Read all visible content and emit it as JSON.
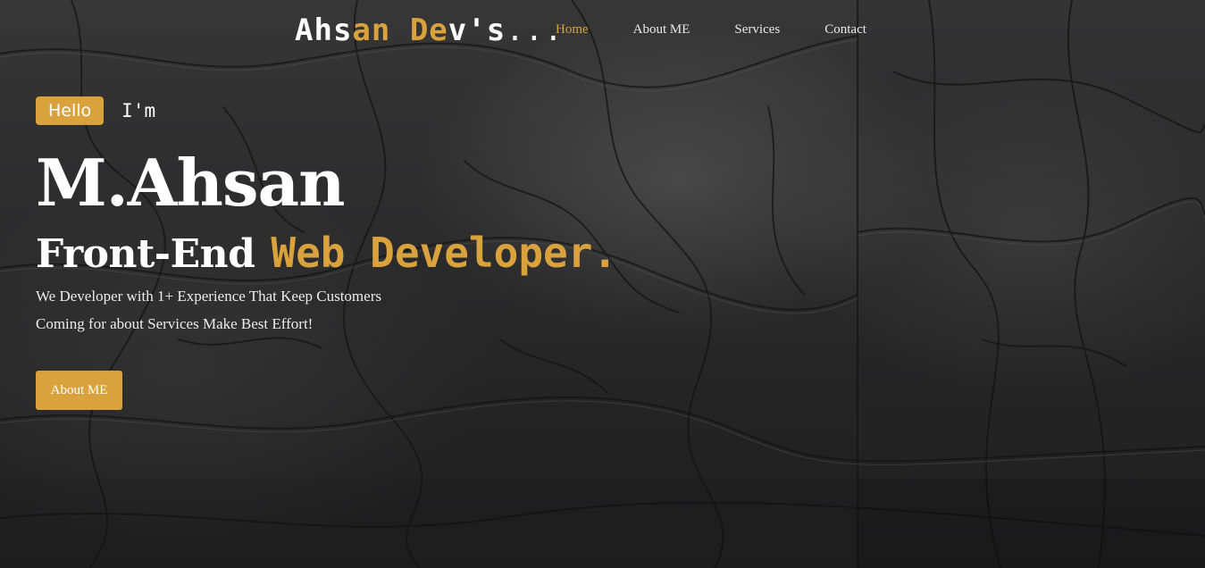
{
  "header": {
    "logo": {
      "part1": "Ahs",
      "part2": "an De",
      "part3": "v's",
      "dots": "..."
    },
    "nav": [
      {
        "label": "Home",
        "active": true
      },
      {
        "label": "About ME",
        "active": false
      },
      {
        "label": "Services",
        "active": false
      },
      {
        "label": "Contact",
        "active": false
      }
    ]
  },
  "hero": {
    "badge": "Hello",
    "intro": "I'm",
    "name": "M.Ahsan",
    "role_prefix": "Front-End",
    "role_highlight": "Web Developer.",
    "description_line1": "We Developer with 1+ Experience That Keep Customers",
    "description_line2": "Coming for about Services Make Best Effort!",
    "cta_label": "About ME"
  },
  "colors": {
    "accent": "#d9a23d",
    "text": "#ffffff",
    "background": "#2f2f30"
  }
}
